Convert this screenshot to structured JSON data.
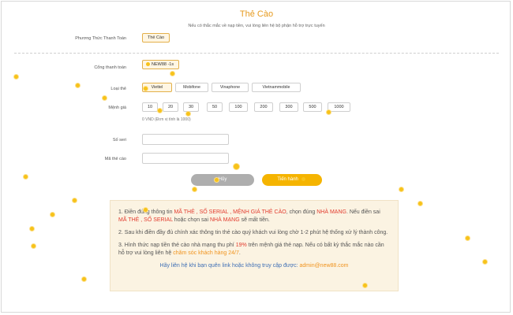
{
  "title": "Thẻ Cào",
  "subtitle": "Nếu có thắc mắc về nạp tiền, vui lòng liên hệ bộ phận hỗ trợ trực tuyến",
  "payment_method": {
    "label": "Phương Thức Thanh Toán",
    "value": "Thẻ Cào"
  },
  "gateway": {
    "label": "Cổng thanh toán",
    "value": "NEW88 -1s"
  },
  "card_type": {
    "label": "Loại thẻ",
    "options": [
      "Viettel",
      "Mobifone",
      "Vinaphone",
      "Vietnammobile"
    ],
    "selected": "Viettel"
  },
  "denomination": {
    "label": "Mệnh giá",
    "options": [
      "10",
      "20",
      "30",
      "50",
      "100",
      "200",
      "300",
      "500",
      "1000"
    ],
    "note": "0 VND (Đơn vị tính là 1000)"
  },
  "serial": {
    "label": "Số seri",
    "value": ""
  },
  "card_code": {
    "label": "Mã thẻ cào",
    "value": ""
  },
  "buttons": {
    "cancel": "Hủy",
    "submit": "Tiến hành"
  },
  "info": {
    "p1": {
      "a": "1. Điền đúng thông tin ",
      "b": "MÃ THẺ , SỐ SERIAL , MỆNH GIÁ THẺ CÀO",
      "c": ", chọn đúng ",
      "d": "NHÀ MẠNG",
      "e": ". Nếu điền sai ",
      "f": "MÃ THẺ , SỐ SERIAL",
      "g": " hoặc chọn sai ",
      "h": "NHÀ MẠNG",
      "i": " sẽ mất tiền."
    },
    "p2": "2. Sau khi điền đầy đủ chính xác thông tin thẻ cào quý khách vui lòng chờ 1-2 phút hệ thống xử lý thành công.",
    "p3": {
      "a": "3. Hình thức nạp tiền thẻ cào nhà mạng thu phí ",
      "b": "19%",
      "c": " trên mệnh giá thẻ nạp. Nếu có bất kỳ thắc mắc nào cần hỗ trợ vui lòng liên hệ ",
      "d": "chăm sóc khách hàng 24/7",
      "e": "."
    },
    "contact": {
      "text": "Hãy liên hệ khi bạn quên link hoặc không truy cập được: ",
      "email": "admin@new88.com"
    }
  },
  "colors": {
    "accent": "#f5b400",
    "title": "#e69a1e",
    "highlight_red": "#e23b2e",
    "highlight_orange": "#f0931e",
    "link": "#3f6fb5"
  }
}
